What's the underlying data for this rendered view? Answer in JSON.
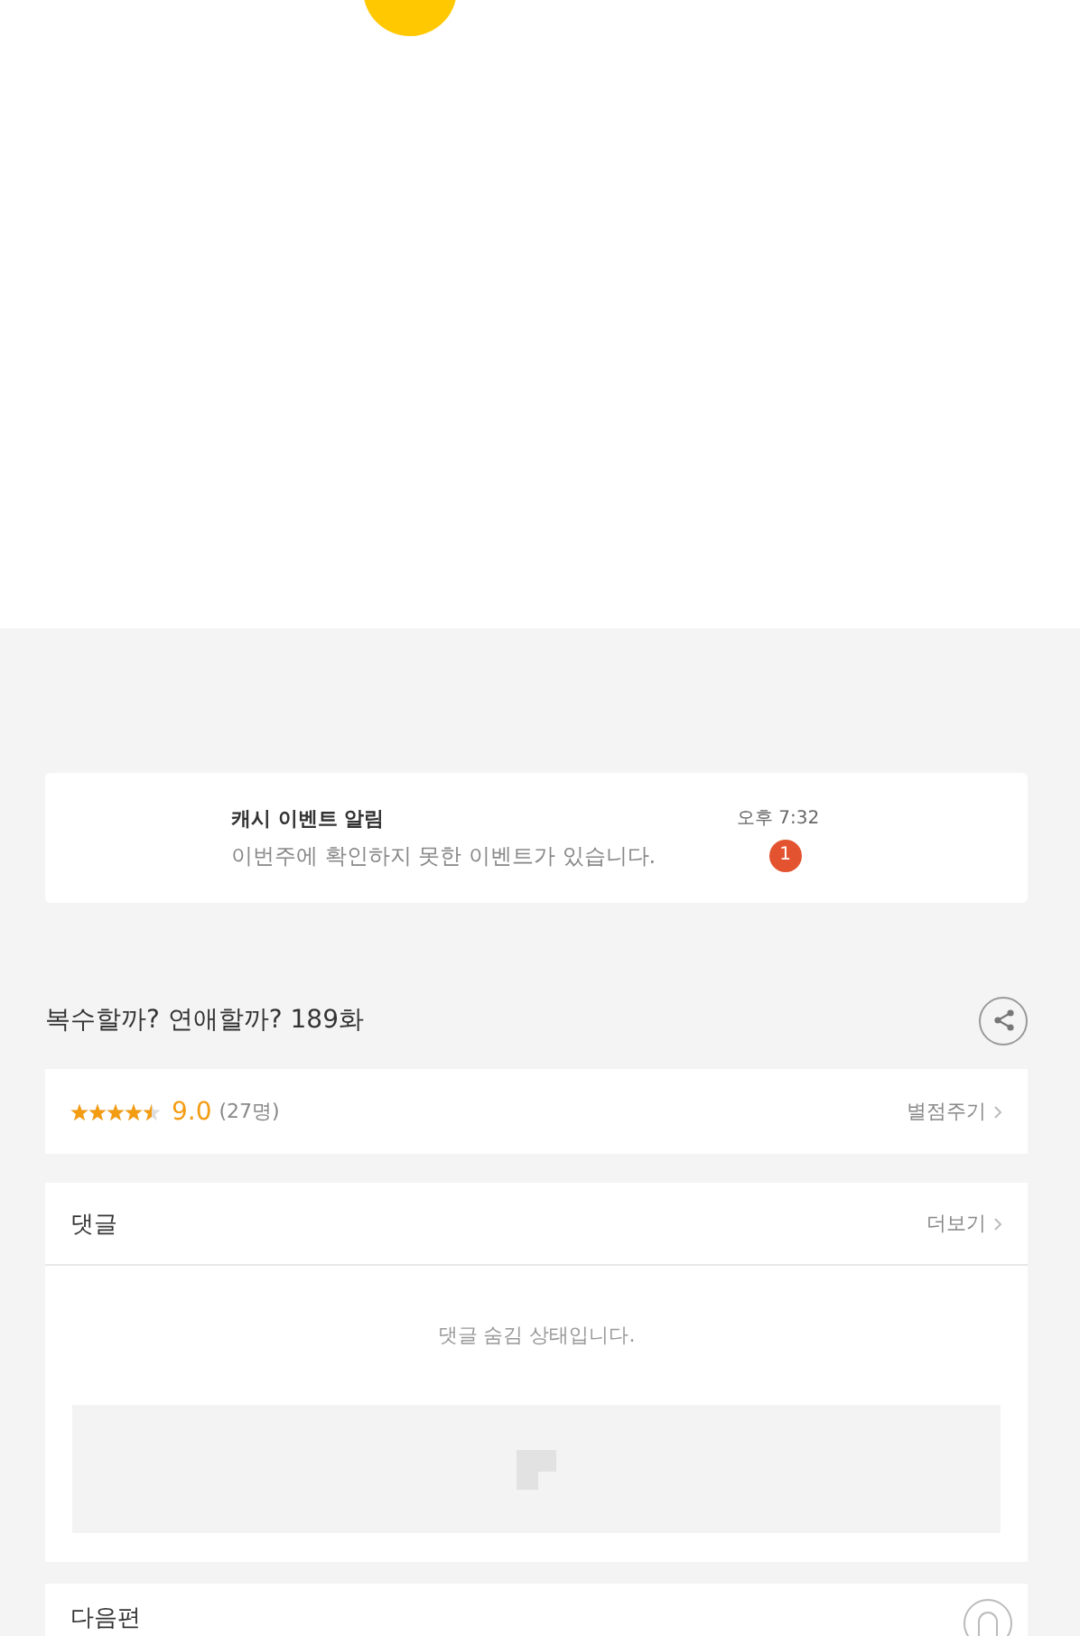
{
  "notification": {
    "title": "캐시 이벤트 알림",
    "message": "이번주에 확인하지 못한 이벤트가 있습니다.",
    "time": "오후 7:32",
    "badge": "1"
  },
  "episode": {
    "title": "복수할까? 연애할까? 189화"
  },
  "rating": {
    "stars": 4.5,
    "score": "9.0",
    "count": "(27명)",
    "action": "별점주기"
  },
  "comments": {
    "title": "댓글",
    "more": "더보기",
    "hidden_message": "댓글 숨김 상태입니다."
  },
  "next": {
    "title": "다음편"
  }
}
